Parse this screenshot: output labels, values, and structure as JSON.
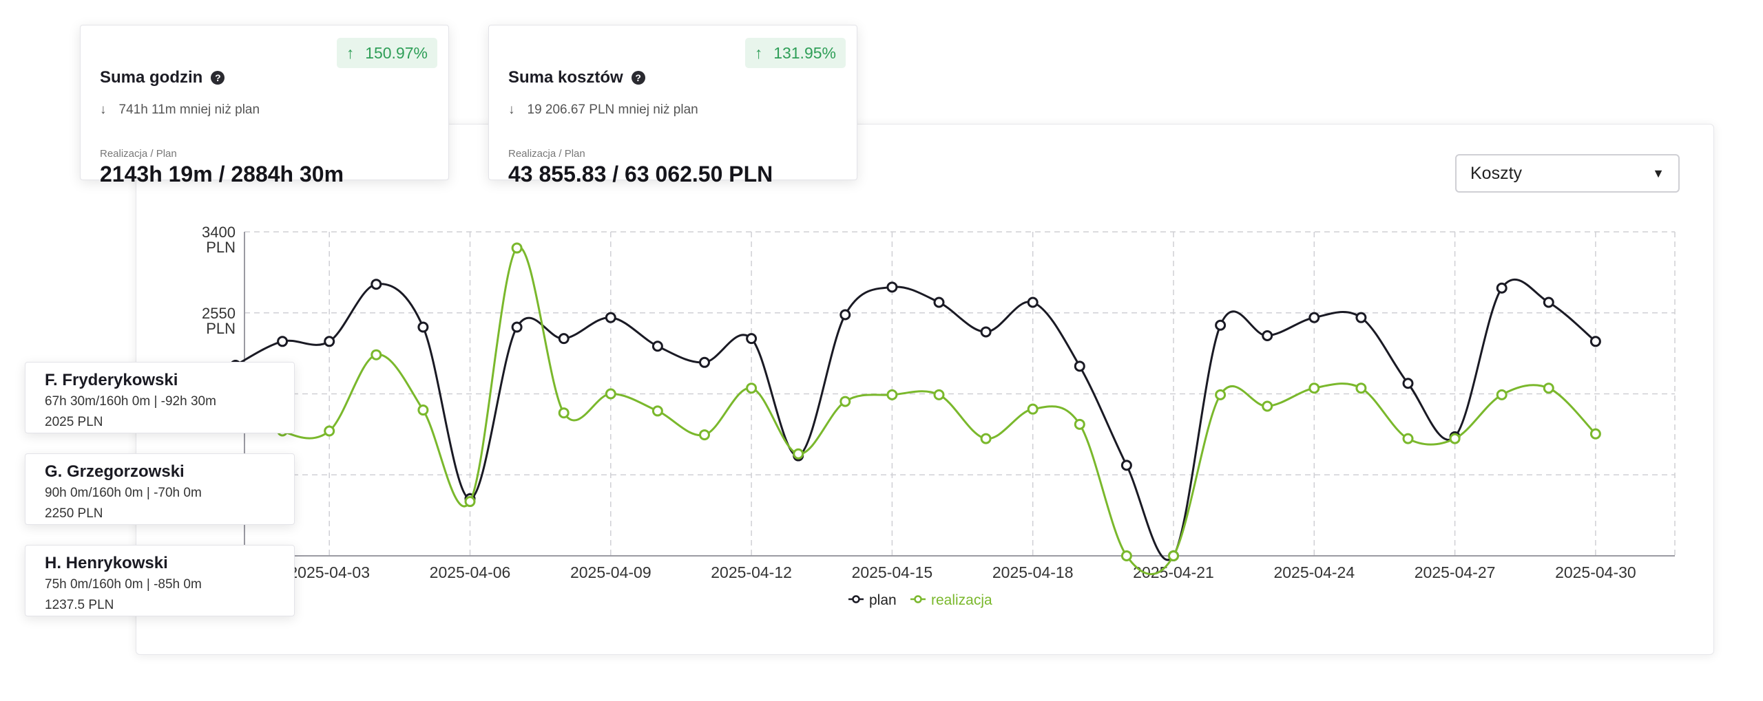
{
  "cards": [
    {
      "title": "Suma godzin",
      "badge": "150.97%",
      "delta": "741h 11m mniej niż plan",
      "sub": "Realizacja / Plan",
      "value": "2143h 19m / 2884h 30m"
    },
    {
      "title": "Suma kosztów",
      "badge": "131.95%",
      "delta": "19 206.67 PLN mniej niż plan",
      "sub": "Realizacja / Plan",
      "value": "43 855.83 / 63 062.50 PLN"
    }
  ],
  "select": {
    "value": "Koszty"
  },
  "employees": [
    {
      "name": "F. Fryderykowski",
      "hours": "67h 30m/160h 0m | -92h 30m",
      "cost": "2025 PLN"
    },
    {
      "name": "G. Grzegorzowski",
      "hours": "90h 0m/160h 0m | -70h 0m",
      "cost": "2250 PLN"
    },
    {
      "name": "H. Henrykowski",
      "hours": "75h 0m/160h 0m | -85h 0m",
      "cost": "1237.5 PLN"
    }
  ],
  "colors": {
    "plan": "#1a1a24",
    "realizacja": "#7ab82c",
    "badge_text": "#2e9e57",
    "badge_bg": "#e8f5ec"
  },
  "icons": {
    "help": "help-circle-icon",
    "up": "arrow-up-icon",
    "down": "arrow-down-icon",
    "caret": "caret-down-icon"
  },
  "chart_data": {
    "type": "line",
    "x": [
      "2025-04-01",
      "2025-04-02",
      "2025-04-03",
      "2025-04-04",
      "2025-04-05",
      "2025-04-06",
      "2025-04-07",
      "2025-04-08",
      "2025-04-09",
      "2025-04-10",
      "2025-04-11",
      "2025-04-12",
      "2025-04-13",
      "2025-04-14",
      "2025-04-15",
      "2025-04-16",
      "2025-04-17",
      "2025-04-18",
      "2025-04-19",
      "2025-04-20",
      "2025-04-21",
      "2025-04-22",
      "2025-04-23",
      "2025-04-24",
      "2025-04-25",
      "2025-04-26",
      "2025-04-27",
      "2025-04-28",
      "2025-04-29",
      "2025-04-30"
    ],
    "x_ticks": [
      "2025-04-03",
      "2025-04-06",
      "2025-04-09",
      "2025-04-12",
      "2025-04-15",
      "2025-04-18",
      "2025-04-21",
      "2025-04-24",
      "2025-04-27",
      "2025-04-30"
    ],
    "y_ticks": [
      {
        "value": 3400,
        "label": [
          "3400",
          "PLN"
        ]
      },
      {
        "value": 2550,
        "label": [
          "2550",
          "PLN"
        ]
      }
    ],
    "ylim": [
      0,
      3400
    ],
    "grid": true,
    "legend": "bottom-center",
    "series": [
      {
        "name": "plan",
        "values": [
          2000,
          2250,
          2250,
          2850,
          2400,
          600,
          2400,
          2280,
          2500,
          2200,
          2030,
          2280,
          1050,
          2530,
          2820,
          2660,
          2350,
          2660,
          1990,
          950,
          0,
          2420,
          2310,
          2500,
          2500,
          1810,
          1250,
          2810,
          2660,
          2250
        ]
      },
      {
        "name": "realizacja",
        "values": [
          1700,
          1310,
          1310,
          2110,
          1530,
          570,
          3230,
          1500,
          1700,
          1520,
          1270,
          1760,
          1070,
          1620,
          1690,
          1690,
          1230,
          1540,
          1380,
          0,
          0,
          1690,
          1570,
          1760,
          1760,
          1230,
          1230,
          1690,
          1760,
          1280
        ]
      }
    ]
  }
}
